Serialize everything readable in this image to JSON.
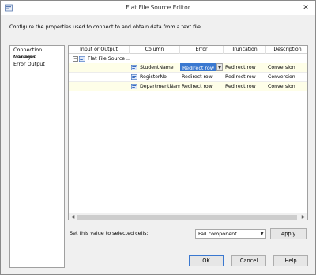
{
  "window": {
    "title": "Flat File Source Editor",
    "close_glyph": "✕"
  },
  "description": "Configure the properties used to connect to and obtain data from a text file.",
  "sidebar": {
    "items": [
      {
        "label": "Connection Manager"
      },
      {
        "label": "Columns"
      },
      {
        "label": "Error Output"
      }
    ]
  },
  "grid": {
    "headers": [
      "Input or Output",
      "Column",
      "Error",
      "Truncation",
      "Description"
    ],
    "tree_node": {
      "label": "Flat File Source ...",
      "expander": "−"
    },
    "rows": [
      {
        "column": "StudentName",
        "error": "Redirect row",
        "truncation": "Redirect row",
        "description": "Conversion"
      },
      {
        "column": "RegisterNo",
        "error": "Redirect row",
        "truncation": "Redirect row",
        "description": "Conversion"
      },
      {
        "column": "DepartmentName",
        "error": "Redirect row",
        "truncation": "Redirect row",
        "description": "Conversion"
      }
    ]
  },
  "set_value": {
    "label": "Set this value to selected cells:",
    "selected": "Fail component",
    "apply_label": "Apply"
  },
  "footer": {
    "ok_label": "OK",
    "cancel_label": "Cancel",
    "help_label": "Help"
  },
  "icons": {
    "window": "component-icon",
    "tree": "source-icon",
    "column": "column-icon"
  },
  "colors": {
    "selection": "#3a78d0",
    "row_highlight": "#fefee8",
    "icon_blue": "#3a6ec0"
  }
}
